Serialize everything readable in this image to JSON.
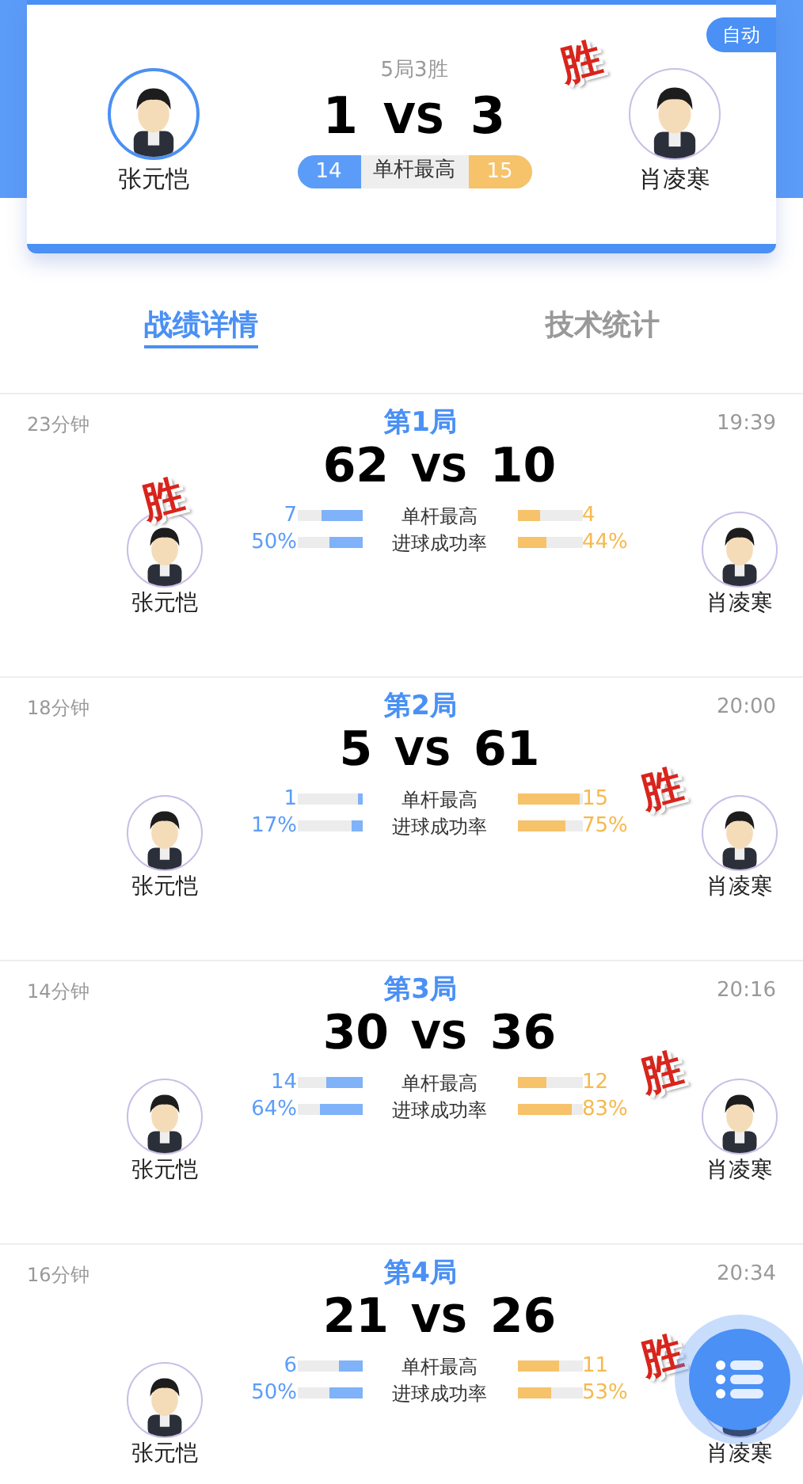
{
  "match": {
    "badge": "自动",
    "format": "5局3胜",
    "left": {
      "name": "张元恺",
      "score": "1",
      "highest": "14",
      "winner": false
    },
    "right": {
      "name": "肖凌寒",
      "score": "3",
      "highest": "15",
      "winner": true
    },
    "vs": "VS",
    "highest_label": "单杆最高",
    "stamp": "胜"
  },
  "tabs": [
    {
      "label": "战绩详情",
      "selected": true
    },
    {
      "label": "技术统计",
      "selected": false
    }
  ],
  "games": [
    {
      "duration": "23分钟",
      "title": "第1局",
      "time": "19:39",
      "vs": "VS",
      "stamp": "胜",
      "left": {
        "name": "张元恺",
        "score": "62",
        "winner": true
      },
      "right": {
        "name": "肖凌寒",
        "score": "10",
        "winner": false
      },
      "stats": [
        {
          "label": "单杆最高",
          "left": {
            "value": "7",
            "level": 0.63
          },
          "right": {
            "value": "4",
            "level": 0.36
          }
        },
        {
          "label": "进球成功率",
          "left": {
            "value": "50%",
            "level": 0.5
          },
          "right": {
            "value": "44%",
            "level": 0.44
          }
        }
      ]
    },
    {
      "duration": "18分钟",
      "title": "第2局",
      "time": "20:00",
      "vs": "VS",
      "stamp": "胜",
      "left": {
        "name": "张元恺",
        "score": "5",
        "winner": false
      },
      "right": {
        "name": "肖凌寒",
        "score": "61",
        "winner": true
      },
      "stats": [
        {
          "label": "单杆最高",
          "left": {
            "value": "1",
            "level": 0.07
          },
          "right": {
            "value": "15",
            "level": 0.97
          }
        },
        {
          "label": "进球成功率",
          "left": {
            "value": "17%",
            "level": 0.17
          },
          "right": {
            "value": "75%",
            "level": 0.75
          }
        }
      ]
    },
    {
      "duration": "14分钟",
      "title": "第3局",
      "time": "20:16",
      "vs": "VS",
      "stamp": "胜",
      "left": {
        "name": "张元恺",
        "score": "30",
        "winner": false
      },
      "right": {
        "name": "肖凌寒",
        "score": "36",
        "winner": true
      },
      "stats": [
        {
          "label": "单杆最高",
          "left": {
            "value": "14",
            "level": 0.54
          },
          "right": {
            "value": "12",
            "level": 0.46
          }
        },
        {
          "label": "进球成功率",
          "left": {
            "value": "64%",
            "level": 0.64
          },
          "right": {
            "value": "83%",
            "level": 0.83
          }
        }
      ]
    },
    {
      "duration": "16分钟",
      "title": "第4局",
      "time": "20:34",
      "vs": "VS",
      "stamp": "胜",
      "left": {
        "name": "张元恺",
        "score": "21",
        "winner": false
      },
      "right": {
        "name": "肖凌寒",
        "score": "26",
        "winner": true
      },
      "stats": [
        {
          "label": "单杆最高",
          "left": {
            "value": "6",
            "level": 0.35
          },
          "right": {
            "value": "11",
            "level": 0.65
          }
        },
        {
          "label": "进球成功率",
          "left": {
            "value": "50%",
            "level": 0.5
          },
          "right": {
            "value": "53%",
            "level": 0.53
          }
        }
      ]
    }
  ]
}
